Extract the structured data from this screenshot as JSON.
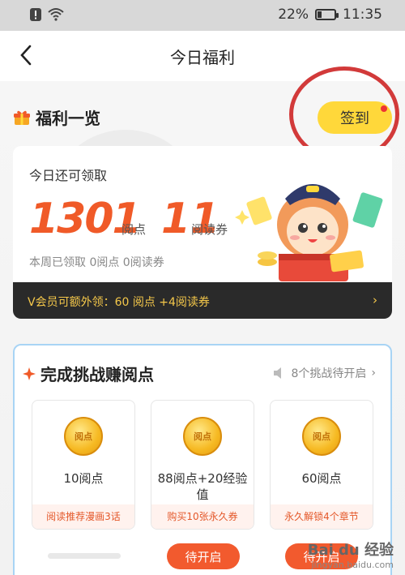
{
  "status_bar": {
    "battery": "22%",
    "time": "11:35",
    "battery_level": 0.22
  },
  "nav": {
    "title": "今日福利"
  },
  "welfare": {
    "title": "福利一览",
    "signin_label": "签到",
    "remaining_label": "今日还可领取",
    "points": "1301",
    "points_unit": "阅点",
    "tickets": "11",
    "tickets_unit": "阅读券",
    "week_info": "本周已领取 0阅点 0阅读券",
    "vip_text": "V会员可额外领：60 阅点 +4阅读券"
  },
  "challenge": {
    "title": "完成挑战赚阅点",
    "pending_text": "8个挑战待开启",
    "coin_label": "阅点",
    "tasks": [
      {
        "reward": "10阅点",
        "desc": "阅读推荐漫画3话"
      },
      {
        "reward": "88阅点+20经验值",
        "desc": "购买10张永久券"
      },
      {
        "reward": "60阅点",
        "desc": "永久解锁4个章节"
      }
    ],
    "start_label": "待开启",
    "progress": 0.0
  },
  "watermark": {
    "logo": "Bai du 经验",
    "sub": "jingyan.baidu.com"
  },
  "colors": {
    "accent": "#f05a28",
    "yellow": "#ffd83a",
    "dark_bar": "#2a2a2a",
    "vip_gold": "#f5c84a",
    "highlight_circle": "#d23a3a"
  }
}
